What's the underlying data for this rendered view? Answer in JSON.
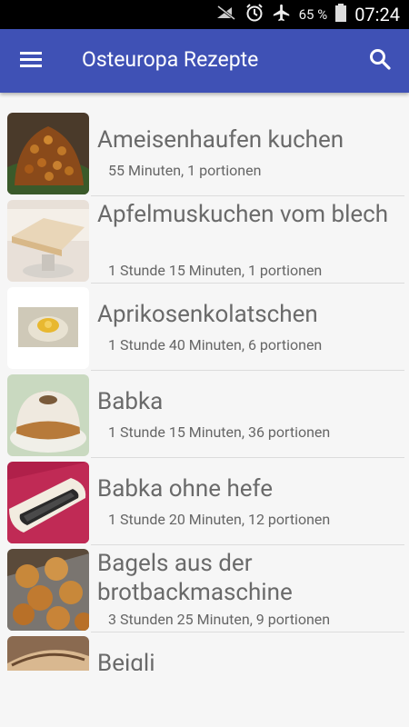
{
  "statusbar": {
    "battery": "65 %",
    "time": "07:24",
    "icons": [
      "no-sim-icon",
      "alarm-icon",
      "airplane-icon",
      "battery-icon"
    ]
  },
  "toolbar": {
    "title": "Osteuropa Rezepte",
    "menu_icon": "hamburger-menu-icon",
    "search_icon": "search-icon",
    "color": "#3f51b5"
  },
  "recipes": [
    {
      "title": "Ameisenhaufen kuchen",
      "meta": "55 Minuten, 1 portionen"
    },
    {
      "title": "Apfelmuskuchen vom blech",
      "meta": "1 Stunde 15 Minuten, 1 portionen"
    },
    {
      "title": "Aprikosenkolatschen",
      "meta": "1 Stunde 40 Minuten, 6 portionen"
    },
    {
      "title": "Babka",
      "meta": "1 Stunde 15 Minuten, 36 portionen"
    },
    {
      "title": "Babka ohne hefe",
      "meta": "1 Stunde 20 Minuten, 12 portionen"
    },
    {
      "title": "Bagels aus der brotbackmaschine",
      "meta": "3 Stunden 25 Minuten, 9 portionen"
    },
    {
      "title": "Beigli",
      "meta": ""
    }
  ]
}
